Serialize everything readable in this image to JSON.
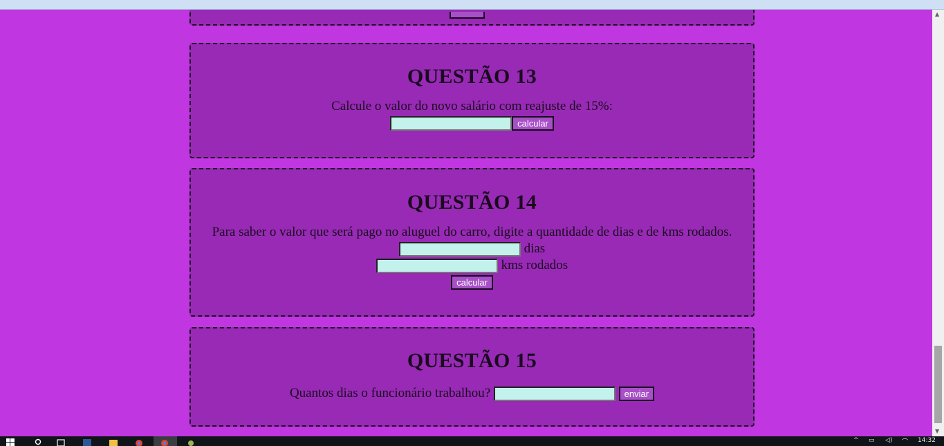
{
  "q12": {
    "button_label": ""
  },
  "q13": {
    "title": "QUESTÃO 13",
    "prompt": "Calcule o valor do novo salário com reajuste de 15%:",
    "input_value": "",
    "button_label": "calcular"
  },
  "q14": {
    "title": "QUESTÃO 14",
    "prompt": "Para saber o valor que será pago no aluguel do carro, digite a quantidade de dias e de kms rodados.",
    "dias_value": "",
    "dias_label": "dias",
    "kms_value": "",
    "kms_label": "kms rodados",
    "button_label": "calcular"
  },
  "q15": {
    "title": "QUESTÃO 15",
    "prompt": "Quantos dias o funcionário trabalhou?",
    "input_value": "",
    "button_label": "enviar"
  },
  "taskbar": {
    "clock": "14:32"
  },
  "colors": {
    "page_bg": "#c036e0",
    "box_bg": "#982ab5",
    "input_bg": "#c3f1ec",
    "button_bg": "#a750c7"
  }
}
